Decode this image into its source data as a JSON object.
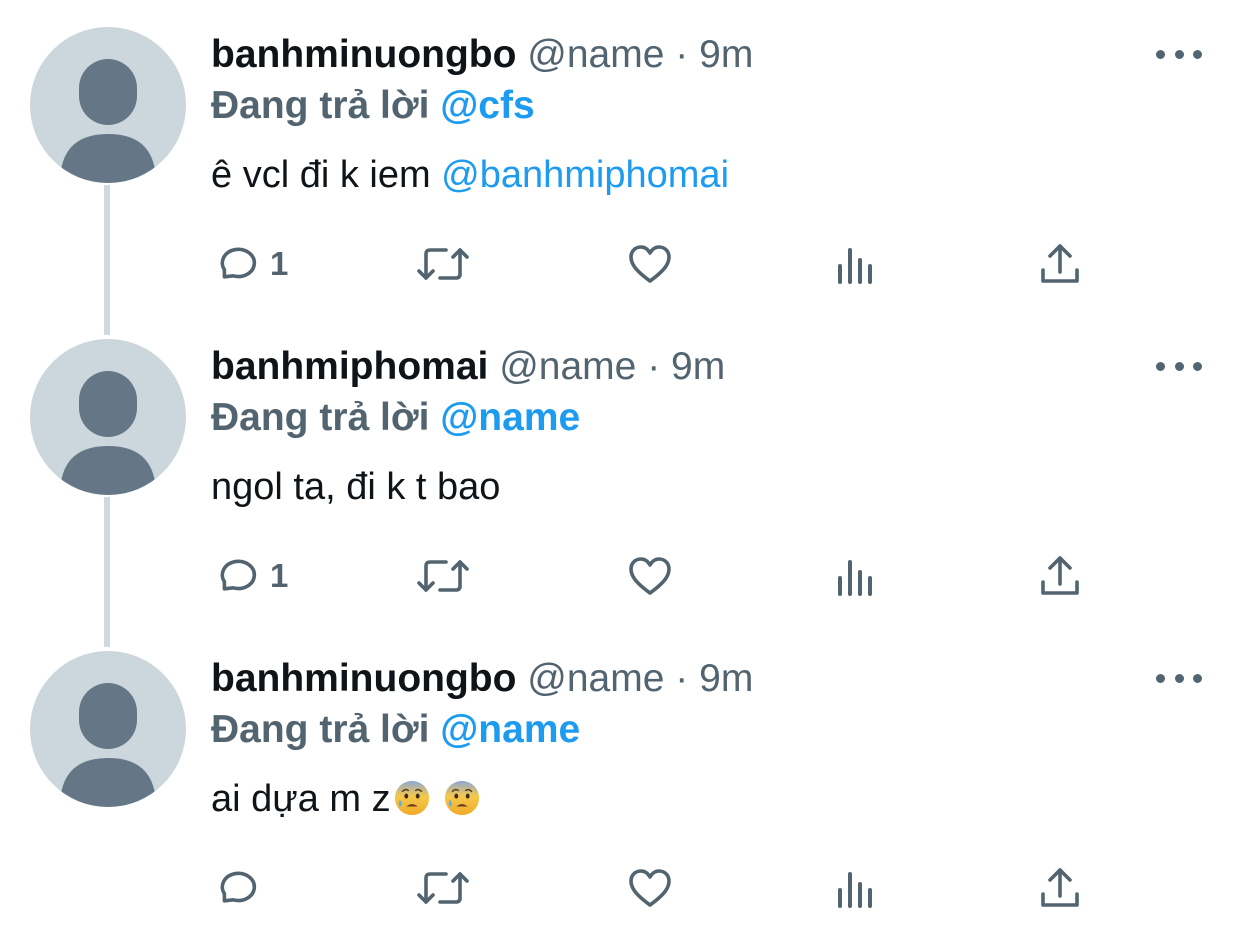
{
  "tweets": [
    {
      "name": "banhminuongbo",
      "handle": "@name",
      "dot": "·",
      "time": "9m",
      "reply_label": "Đang trả lời",
      "reply_to": "@cfs",
      "body_text": "ê vcl đi k iem ",
      "body_mention": "@banhmiphomai",
      "reply_count": "1"
    },
    {
      "name": "banhmiphomai",
      "handle": "@name",
      "dot": "·",
      "time": "9m",
      "reply_label": "Đang trả lời",
      "reply_to": "@name",
      "body_text": "ngol ta, đi k t bao",
      "reply_count": "1"
    },
    {
      "name": "banhminuongbo",
      "handle": "@name",
      "dot": "·",
      "time": "9m",
      "reply_label": "Đang trả lời",
      "reply_to": "@name",
      "body_text": "ai dựa m z",
      "emojis": [
        "anxious-face-with-sweat",
        "anxious-face-with-sweat"
      ]
    }
  ],
  "icons": {
    "more": "more-horizontal-icon",
    "reply": "reply-bubble-icon",
    "retweet": "retweet-icon",
    "like": "heart-icon",
    "views": "views-chart-icon",
    "share": "share-icon"
  },
  "colors": {
    "text": "#0f1419",
    "secondary": "#536471",
    "accent": "#1d9bf0",
    "avatar_bg": "#ccd6dd",
    "avatar_fg": "#657786",
    "thread_line": "#cfd9de"
  }
}
